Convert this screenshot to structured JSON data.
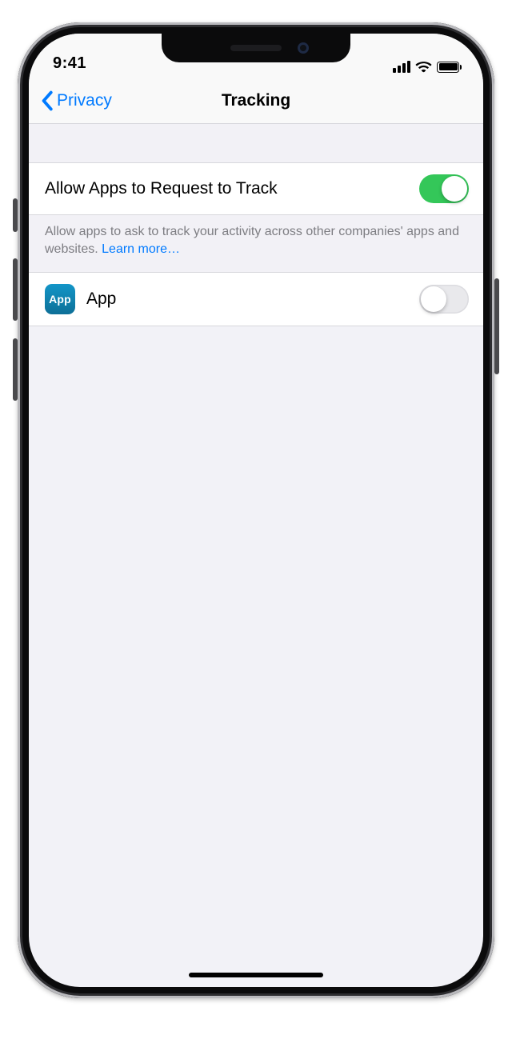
{
  "status": {
    "time": "9:41"
  },
  "nav": {
    "back_label": "Privacy",
    "title": "Tracking"
  },
  "settings": {
    "allow_request": {
      "label": "Allow Apps to Request to Track",
      "on": true
    },
    "description": "Allow apps to ask to track your activity across other companies' apps and websites. ",
    "learn_more": "Learn more…"
  },
  "apps": [
    {
      "icon_text": "App",
      "name": "App",
      "on": false
    }
  ]
}
